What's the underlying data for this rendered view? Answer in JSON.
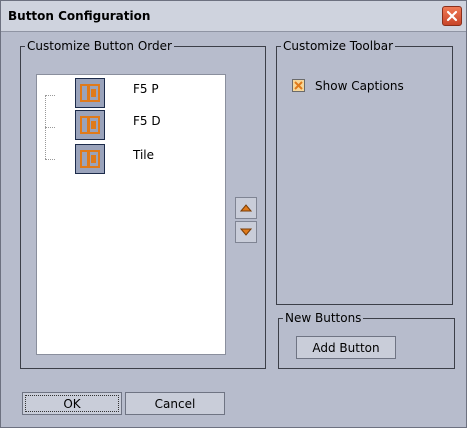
{
  "window": {
    "title": "Button Configuration"
  },
  "order_group": {
    "legend": "Customize Button Order",
    "items": [
      {
        "label": "F5 P",
        "icon": "toolbar-button-icon"
      },
      {
        "label": "F5 D",
        "icon": "toolbar-button-icon"
      },
      {
        "label": "Tile",
        "icon": "toolbar-button-icon"
      }
    ],
    "move_up_icon": "arrow-up-icon",
    "move_down_icon": "arrow-down-icon"
  },
  "toolbar_group": {
    "legend": "Customize Toolbar",
    "show_captions_label": "Show Captions",
    "show_captions_checked": true
  },
  "new_buttons_group": {
    "legend": "New Buttons",
    "add_button_label": "Add Button"
  },
  "footer": {
    "ok_label": "OK",
    "cancel_label": "Cancel"
  },
  "colors": {
    "accent": "#e07a1a",
    "checkbox_fill": "#f6d79a",
    "close_red": "#d9532f"
  }
}
